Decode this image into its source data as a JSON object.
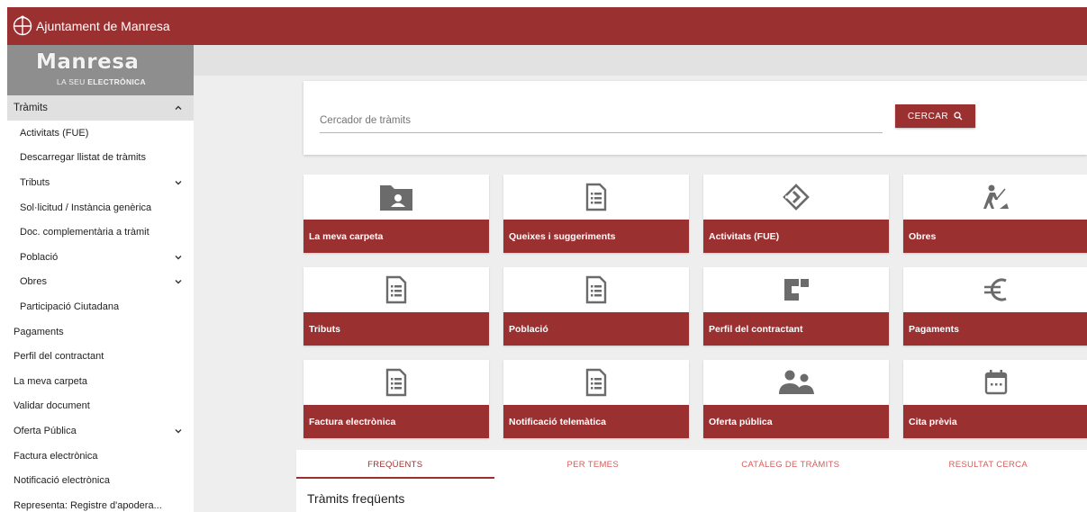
{
  "header": {
    "title": "Ajuntament de Manresa",
    "crest_icon": "manresa-crest-icon"
  },
  "brand": {
    "logo_text": "Manresa",
    "subtitle_light": "LA SEU",
    "subtitle_bold": "ELECTRÒNICA"
  },
  "sidebar": {
    "section": "Tràmits",
    "sub_items": [
      {
        "label": "Activitats (FUE)",
        "expandable": false
      },
      {
        "label": "Descarregar llistat de tràmits",
        "expandable": false
      },
      {
        "label": "Tributs",
        "expandable": true
      },
      {
        "label": "Sol·licitud / Instància genèrica",
        "expandable": false
      },
      {
        "label": "Doc. complementària a tràmit",
        "expandable": false
      },
      {
        "label": "Població",
        "expandable": true
      },
      {
        "label": "Obres",
        "expandable": true
      },
      {
        "label": "Participació Ciutadana",
        "expandable": false
      }
    ],
    "items": [
      {
        "label": "Pagaments",
        "expandable": false
      },
      {
        "label": "Perfil del contractant",
        "expandable": false
      },
      {
        "label": "La meva carpeta",
        "expandable": false
      },
      {
        "label": "Validar document",
        "expandable": false
      },
      {
        "label": "Oferta Pública",
        "expandable": true
      },
      {
        "label": "Factura electrònica",
        "expandable": false
      },
      {
        "label": "Notificació electrònica",
        "expandable": false
      },
      {
        "label": "Representa: Registre d'apodera...",
        "expandable": false
      }
    ]
  },
  "search": {
    "placeholder": "Cercador de tràmits",
    "button_label": "CERCAR"
  },
  "tiles": [
    {
      "label": "La meva carpeta",
      "icon": "folder-user-icon"
    },
    {
      "label": "Queixes i suggeriments",
      "icon": "document-list-icon"
    },
    {
      "label": "Activitats (FUE)",
      "icon": "diamond-arrow-icon"
    },
    {
      "label": "Obres",
      "icon": "construction-worker-icon"
    },
    {
      "label": "Tributs",
      "icon": "document-list-icon"
    },
    {
      "label": "Població",
      "icon": "document-list-icon"
    },
    {
      "label": "Perfil del contractant",
      "icon": "contract-profile-icon"
    },
    {
      "label": "Pagaments",
      "icon": "euro-icon"
    },
    {
      "label": "Factura electrònica",
      "icon": "document-list-icon"
    },
    {
      "label": "Notificació telemàtica",
      "icon": "document-list-icon"
    },
    {
      "label": "Oferta pública",
      "icon": "people-icon"
    },
    {
      "label": "Cita prèvia",
      "icon": "calendar-icon"
    }
  ],
  "tabs": [
    {
      "label": "FREQÜENTS",
      "active": true
    },
    {
      "label": "PER TEMES",
      "active": false
    },
    {
      "label": "CATÀLEG DE TRÀMITS",
      "active": false
    },
    {
      "label": "RESULTAT CERCA",
      "active": false
    }
  ],
  "section_title": "Tràmits freqüents",
  "colors": {
    "brand": "#9b3031",
    "icon": "#6b6b6b",
    "tab_inactive": "#d65b5b"
  }
}
